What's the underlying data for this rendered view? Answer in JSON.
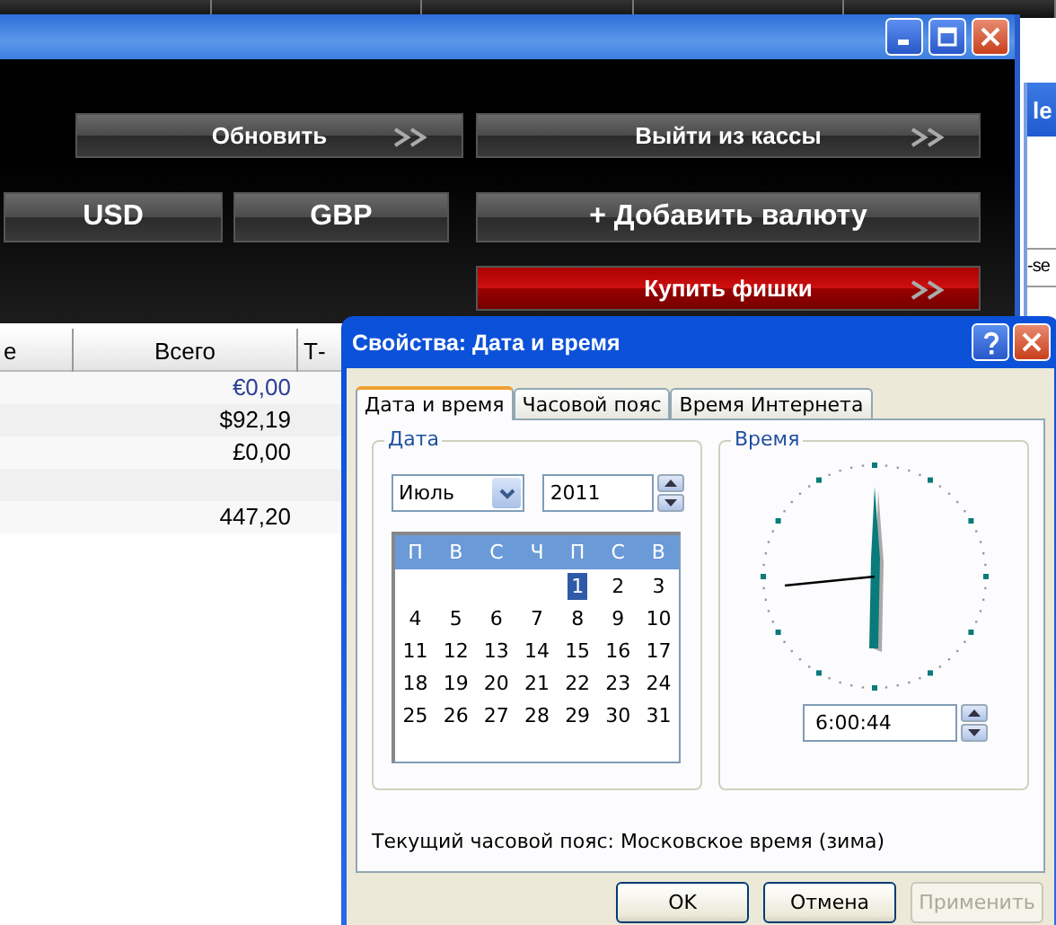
{
  "app_window": {
    "button_rows": [
      [
        {
          "label": "Обновить",
          "kind": "normal",
          "arrows": true
        },
        {
          "label": "Выйти из кассы",
          "kind": "normal",
          "arrows": true
        }
      ],
      [
        {
          "label": "USD",
          "kind": "normal",
          "arrows": false
        },
        {
          "label": "GBP",
          "kind": "normal",
          "arrows": false
        },
        {
          "label": "+ Добавить валюту",
          "kind": "normal",
          "arrows": false
        }
      ],
      [
        {
          "label": "Купить фишки",
          "kind": "accent",
          "arrows": true
        }
      ]
    ],
    "table": {
      "columns": [
        "е",
        "Всего",
        "Т-"
      ],
      "rows": [
        {
          "total": "€0,00",
          "color": "#2b3f96"
        },
        {
          "total": "$92,19",
          "color": "#000000"
        },
        {
          "total": "£0,00",
          "color": "#000000"
        },
        {},
        {
          "total": "447,20",
          "color": "#000000"
        }
      ]
    }
  },
  "background_window": {
    "title": "le",
    "field": "-se"
  },
  "dialog": {
    "title": "Свойства: Дата и время",
    "tabs": [
      {
        "label": "Дата и время",
        "selected": true
      },
      {
        "label": "Часовой пояс",
        "selected": false
      },
      {
        "label": "Время Интернета",
        "selected": false
      }
    ],
    "date_group": {
      "title": "Дата",
      "month": "Июль",
      "year": "2011",
      "weekdays": [
        "П",
        "В",
        "С",
        "Ч",
        "П",
        "С",
        "В"
      ],
      "weeks": [
        [
          {
            "day": "1",
            "selected": true
          },
          {
            "day": "2",
            "selected": false
          },
          {
            "day": "3",
            "selected": false
          }
        ],
        [
          {
            "day": "4",
            "selected": false
          },
          {
            "day": "5",
            "selected": false
          },
          {
            "day": "6",
            "selected": false
          },
          {
            "day": "7",
            "selected": false
          },
          {
            "day": "8",
            "selected": false
          },
          {
            "day": "9",
            "selected": false
          },
          {
            "day": "10",
            "selected": false
          }
        ],
        [
          {
            "day": "11",
            "selected": false
          },
          {
            "day": "12",
            "selected": false
          },
          {
            "day": "13",
            "selected": false
          },
          {
            "day": "14",
            "selected": false
          },
          {
            "day": "15",
            "selected": false
          },
          {
            "day": "16",
            "selected": false
          },
          {
            "day": "17",
            "selected": false
          }
        ],
        [
          {
            "day": "18",
            "selected": false
          },
          {
            "day": "19",
            "selected": false
          },
          {
            "day": "20",
            "selected": false
          },
          {
            "day": "21",
            "selected": false
          },
          {
            "day": "22",
            "selected": false
          },
          {
            "day": "23",
            "selected": false
          },
          {
            "day": "24",
            "selected": false
          }
        ],
        [
          {
            "day": "25",
            "selected": false
          },
          {
            "day": "26",
            "selected": false
          },
          {
            "day": "27",
            "selected": false
          },
          {
            "day": "28",
            "selected": false
          },
          {
            "day": "29",
            "selected": false
          },
          {
            "day": "30",
            "selected": false
          },
          {
            "day": "31",
            "selected": false
          }
        ]
      ]
    },
    "time_group": {
      "title": "Время",
      "time": "6:00:44"
    },
    "timezone_text": "Текущий часовой пояс: Московское время (зима)",
    "buttons": [
      {
        "label": "OK",
        "disabled": false
      },
      {
        "label": "Отмена",
        "disabled": false
      },
      {
        "label": "Применить",
        "disabled": true
      }
    ]
  }
}
